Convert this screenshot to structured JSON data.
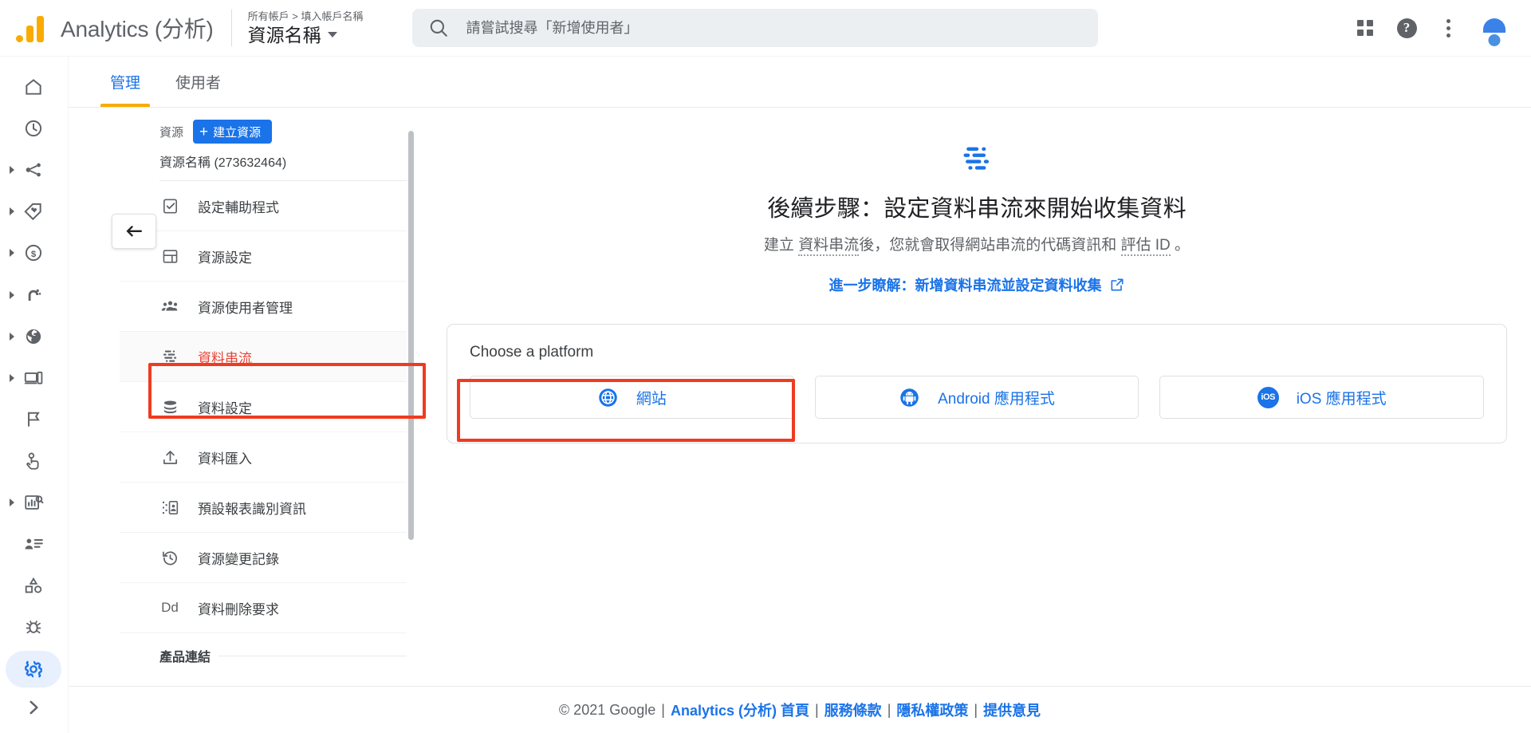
{
  "topbar": {
    "logo_icon": "analytics-logo-icon",
    "brand": "Analytics (分析)",
    "account_breadcrumb": "所有帳戶 > 填入帳戶名稱",
    "property_selector": "資源名稱",
    "search": {
      "icon": "search-icon",
      "placeholder": "請嘗試搜尋「新增使用者」",
      "value": ""
    },
    "apps_icon": "apps-grid-icon",
    "help_icon": "help-icon",
    "help_glyph": "?",
    "more_icon": "kebab-menu-icon",
    "avatar_icon": "account-avatar-icon"
  },
  "rail": {
    "items": [
      {
        "icon": "home-icon",
        "expandable": false,
        "active": false
      },
      {
        "icon": "realtime-clock-icon",
        "expandable": false,
        "active": false
      },
      {
        "icon": "acquisition-share-icon",
        "expandable": true,
        "active": false
      },
      {
        "icon": "tag-icon",
        "expandable": true,
        "active": false
      },
      {
        "icon": "monetization-dollar-icon",
        "expandable": true,
        "active": false
      },
      {
        "icon": "retention-magnet-icon",
        "expandable": true,
        "active": false
      },
      {
        "icon": "demographics-globe-icon",
        "expandable": true,
        "active": false
      },
      {
        "icon": "tech-devices-icon",
        "expandable": true,
        "active": false
      },
      {
        "icon": "flag-icon",
        "expandable": false,
        "active": false
      },
      {
        "icon": "advertising-hand-icon",
        "expandable": false,
        "active": false
      },
      {
        "icon": "explore-chart-search-icon",
        "expandable": true,
        "active": false
      },
      {
        "icon": "audience-person-list-icon",
        "expandable": false,
        "active": false
      },
      {
        "icon": "shapes-events-icon",
        "expandable": false,
        "active": false
      },
      {
        "icon": "debug-bug-icon",
        "expandable": false,
        "active": false
      },
      {
        "icon": "settings-gear-icon",
        "expandable": false,
        "active": true
      }
    ],
    "expand_icon": "chevron-right-icon"
  },
  "tabs": [
    {
      "label": "管理",
      "active": true
    },
    {
      "label": "使用者",
      "active": false
    }
  ],
  "property_panel": {
    "collapse_icon": "back-arrow-icon",
    "section_label": "資源",
    "create_button": {
      "plus": "+",
      "label": "建立資源"
    },
    "property_name": "資源名稱 (273632464)",
    "menu": [
      {
        "label": "設定輔助程式",
        "icon": "setup-assistant-icon",
        "selected": false
      },
      {
        "label": "資源設定",
        "icon": "property-settings-icon",
        "selected": false
      },
      {
        "label": "資源使用者管理",
        "icon": "property-users-icon",
        "selected": false
      },
      {
        "label": "資料串流",
        "icon": "data-streams-icon",
        "selected": true
      },
      {
        "label": "資料設定",
        "icon": "data-settings-icon",
        "selected": false
      },
      {
        "label": "資料匯入",
        "icon": "data-import-icon",
        "selected": false
      },
      {
        "label": "預設報表識別資訊",
        "icon": "reporting-identity-icon",
        "selected": false
      },
      {
        "label": "資源變更記錄",
        "icon": "change-history-icon",
        "selected": false
      },
      {
        "label": "資料刪除要求",
        "icon": "Dd",
        "icon_is_text": true,
        "selected": false
      }
    ],
    "next_section_title": "產品連結"
  },
  "main": {
    "hero_icon": "data-streams-icon",
    "heading": "後續步驟：設定資料串流來開始收集資料",
    "subtitle_parts": [
      {
        "text": "建立 ",
        "dotted": false
      },
      {
        "text": "資料串流",
        "dotted": true
      },
      {
        "text": "後，您就會取得網站串流的代碼資訊和 ",
        "dotted": false
      },
      {
        "text": "評估 ID",
        "dotted": true
      },
      {
        "text": " 。",
        "dotted": false
      }
    ],
    "learn_more": {
      "label": "進一步瞭解：新增資料串流並設定資料收集",
      "icon": "external-link-icon"
    },
    "platform_card": {
      "title": "Choose a platform",
      "buttons": [
        {
          "label": "網站",
          "icon": "globe-web-icon"
        },
        {
          "label": "Android 應用程式",
          "icon": "android-icon"
        },
        {
          "label": "iOS 應用程式",
          "icon": "ios-icon",
          "badge": "iOS"
        }
      ]
    }
  },
  "annotations": [
    {
      "name": "highlight-data-streams-menu",
      "color": "#ef3b20"
    },
    {
      "name": "highlight-web-platform-button",
      "color": "#ef3b20"
    }
  ],
  "footer": {
    "copyright": "© 2021 Google",
    "links": [
      "Analytics (分析) 首頁",
      "服務條款",
      "隱私權政策",
      "提供意見"
    ],
    "separator": "|"
  },
  "colors": {
    "brand_blue": "#1a73e8",
    "accent_orange": "#f9ab00",
    "highlight_red": "#ef3b20",
    "selected_red_text": "#ea4335",
    "text_primary": "#202124",
    "text_secondary": "#5f6368"
  }
}
